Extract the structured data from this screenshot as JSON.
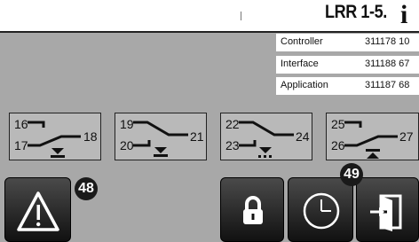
{
  "header": {
    "title": "LRR 1-5.",
    "info_icon": "info-icon"
  },
  "versions": [
    {
      "label": "Controller",
      "value": "311178 10"
    },
    {
      "label": "Interface",
      "value": "311188 67"
    },
    {
      "label": "Application",
      "value": "311187 68"
    }
  ],
  "relays": [
    {
      "terminal_top": "16",
      "terminal_bottom": "17",
      "terminal_common": "18"
    },
    {
      "terminal_top": "19",
      "terminal_bottom": "20",
      "terminal_common": "21"
    },
    {
      "terminal_top": "22",
      "terminal_bottom": "23",
      "terminal_common": "24"
    },
    {
      "terminal_top": "25",
      "terminal_bottom": "26",
      "terminal_common": "27"
    }
  ],
  "buttons": {
    "warning": {
      "icon": "warning-icon"
    },
    "lock": {
      "icon": "lock-icon"
    },
    "clock": {
      "icon": "clock-icon"
    },
    "exit": {
      "icon": "exit-door-icon"
    }
  },
  "callouts": {
    "warning": "48",
    "clock": "49"
  },
  "colors": {
    "background": "#a8a8a8",
    "panel": "#b9b9b9",
    "dark_button": "#111111"
  }
}
